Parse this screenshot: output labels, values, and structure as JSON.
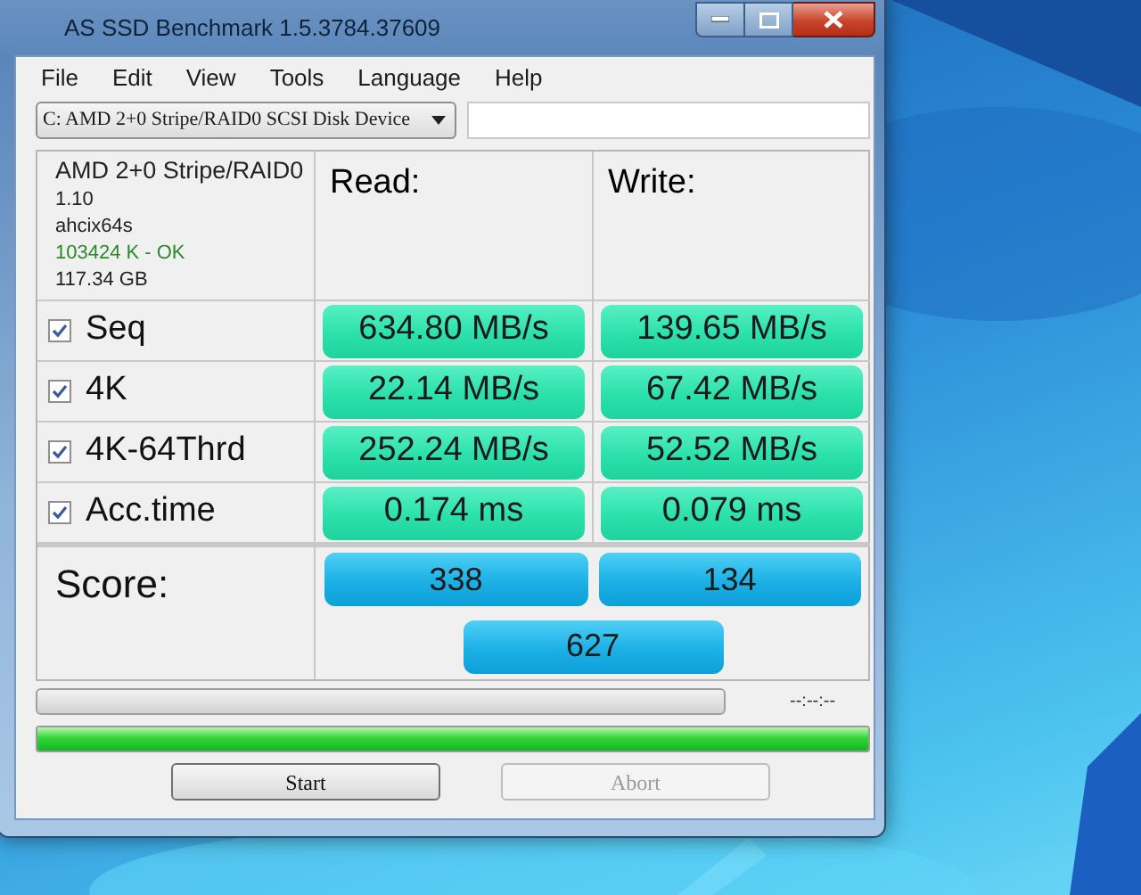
{
  "window": {
    "title": "AS SSD Benchmark 1.5.3784.37609"
  },
  "menu": [
    "File",
    "Edit",
    "View",
    "Tools",
    "Language",
    "Help"
  ],
  "drive_select": {
    "value": "C: AMD 2+0 Stripe/RAID0 SCSI Disk Device"
  },
  "device_info": {
    "name": "AMD 2+0 Stripe/RAID0",
    "firmware": "1.10",
    "driver": "ahcix64s",
    "alignment": "103424 K - OK",
    "alignment_ok": true,
    "size": "117.34 GB"
  },
  "headers": {
    "read": "Read:",
    "write": "Write:"
  },
  "tests": [
    {
      "label": "Seq",
      "checked": true,
      "read": "634.80 MB/s",
      "write": "139.65 MB/s"
    },
    {
      "label": "4K",
      "checked": true,
      "read": "22.14 MB/s",
      "write": "67.42 MB/s"
    },
    {
      "label": "4K-64Thrd",
      "checked": true,
      "read": "252.24 MB/s",
      "write": "52.52 MB/s"
    },
    {
      "label": "Acc.time",
      "checked": true,
      "read": "0.174 ms",
      "write": "0.079 ms"
    }
  ],
  "score": {
    "label": "Score:",
    "read": "338",
    "write": "134",
    "total": "627"
  },
  "progress": {
    "level": 0,
    "time": "--:--:--"
  },
  "overall_progress": {
    "level": 1
  },
  "buttons": [
    {
      "label": "Start",
      "disabled": false
    },
    {
      "label": "Abort",
      "disabled": true
    }
  ]
}
